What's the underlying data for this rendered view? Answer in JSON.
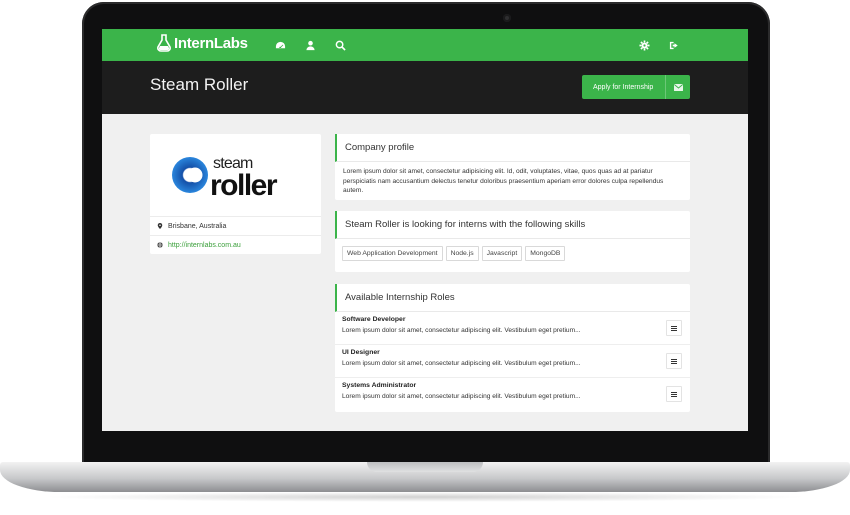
{
  "app": {
    "logo_text": "InternLabs"
  },
  "nav": {
    "icons": [
      "dashboard-icon",
      "user-icon",
      "search-icon",
      "gear-icon",
      "logout-icon"
    ]
  },
  "header": {
    "title": "Steam Roller",
    "apply_label": "Apply for Internship"
  },
  "company": {
    "logo_text_top": "steam",
    "logo_text_bottom": "roller",
    "location": "Brisbane, Australia",
    "website": "http://internlabs.com.au"
  },
  "profile": {
    "heading": "Company profile",
    "text": "Lorem ipsum dolor sit amet, consectetur adipisicing elit. Id, odit, voluptates, vitae, quos quas ad at pariatur perspiciatis nam accusantium delectus tenetur doloribus praesentium aperiam error dolores culpa repellendus autem."
  },
  "skills": {
    "heading": "Steam Roller is looking for interns with the following skills",
    "items": [
      "Web Application Development",
      "Node.js",
      "Javascript",
      "MongoDB"
    ]
  },
  "roles": {
    "heading": "Available Internship Roles",
    "items": [
      {
        "title": "Software Developer",
        "desc": "Lorem ipsum dolor sit amet, consectetur adipiscing elit. Vestibulum eget pretium..."
      },
      {
        "title": "UI Designer",
        "desc": "Lorem ipsum dolor sit amet, consectetur adipiscing elit. Vestibulum eget pretium..."
      },
      {
        "title": "Systems Administrator",
        "desc": "Lorem ipsum dolor sit amet, consectetur adipiscing elit. Vestibulum eget pretium..."
      }
    ]
  },
  "colors": {
    "brand_green": "#3bb44a",
    "header_dark": "#1d1d1d",
    "logo_blue": "#1d6fc4"
  }
}
